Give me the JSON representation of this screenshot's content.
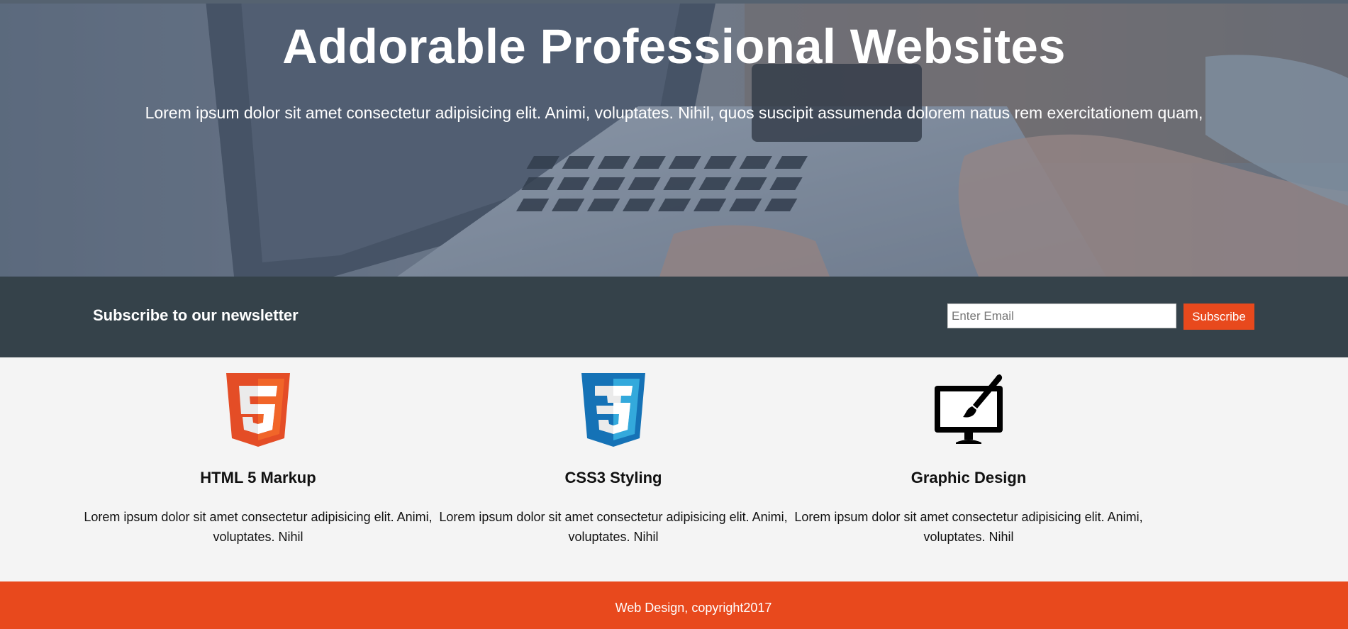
{
  "hero": {
    "title": "Addorable Professional Websites",
    "text": "Lorem ipsum dolor sit amet consectetur adipisicing elit. Animi, voluptates. Nihil, quos suscipit assumenda dolorem natus rem exercitationem quam,"
  },
  "newsletter": {
    "heading": "Subscribe to our newsletter",
    "email_placeholder": "Enter Email",
    "email_value": "",
    "subscribe_label": "Subscribe"
  },
  "boxes": [
    {
      "icon": "html5-logo-icon",
      "title": "HTML 5 Markup",
      "text": "Lorem ipsum dolor sit amet consectetur adipisicing elit. Animi, voluptates. Nihil"
    },
    {
      "icon": "css3-logo-icon",
      "title": "CSS3 Styling",
      "text": "Lorem ipsum dolor sit amet consectetur adipisicing elit. Animi, voluptates. Nihil"
    },
    {
      "icon": "monitor-brush-icon",
      "title": "Graphic Design",
      "text": "Lorem ipsum dolor sit amet consectetur adipisicing elit. Animi, voluptates. Nihil"
    }
  ],
  "footer": {
    "text": "Web Design, copyright2017"
  },
  "colors": {
    "accent": "#e8491d",
    "dark_bar": "#35424a",
    "content_bg": "#f4f4f4",
    "html5_orange": "#e44d26",
    "css3_blue": "#1572b6"
  }
}
